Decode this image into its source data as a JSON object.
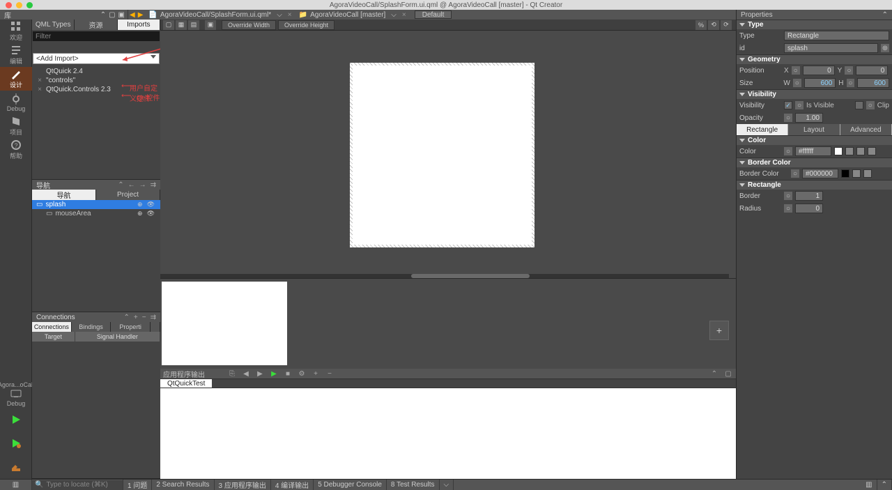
{
  "title": "AgoraVideoCall/SplashForm.ui.qml @ AgoraVideoCall [master] - Qt Creator",
  "filebar": {
    "library_label": "库",
    "crumb": "AgoraVideoCall/SplashForm.ui.qml*",
    "crumb2": "AgoraVideoCall [master]",
    "default_kit": "Default"
  },
  "rail": {
    "welcome": "欢迎",
    "edit": "编辑",
    "design": "设计",
    "debug": "Debug",
    "projects": "项目",
    "help": "帮助",
    "kit": "Agora...oCall",
    "kit2": "Debug"
  },
  "library": {
    "tabs": {
      "qml_types": "QML Types",
      "resources": "资源",
      "imports": "Imports"
    },
    "filter_placeholder": "Filter",
    "add_import": "<Add Import>",
    "items": [
      {
        "x": false,
        "label": "QtQuick 2.4"
      },
      {
        "x": true,
        "label": "\"controls\""
      },
      {
        "x": true,
        "label": "QtQuick.Controls 2.3"
      }
    ],
    "anno1": "用户自定义控件",
    "anno2": "Qt 控件"
  },
  "navigator": {
    "title": "导航",
    "tabs": {
      "nav": "导航",
      "project": "Project"
    },
    "rows": [
      {
        "label": "splash",
        "icon": "rect"
      },
      {
        "label": "mouseArea",
        "icon": "mouse"
      }
    ]
  },
  "connections": {
    "title": "Connections",
    "tabs": {
      "connections": "Connections",
      "bindings": "Bindings",
      "properties": "Properti"
    },
    "sub": {
      "target": "Target",
      "signal": "Signal Handler"
    }
  },
  "centerToolbar": {
    "override_width": "Override Width",
    "override_height": "Override Height"
  },
  "states": {
    "add": "+"
  },
  "output": {
    "title": "应用程序输出",
    "tab": "QtQuickTest"
  },
  "properties": {
    "title": "Properties",
    "type_section": "Type",
    "type_value": "Rectangle",
    "id_label": "id",
    "id_value": "splash",
    "geometry_section": "Geometry",
    "position_label": "Position",
    "size_label": "Size",
    "x": "X",
    "y": "Y",
    "w": "W",
    "h": "H",
    "xv": "0",
    "yv": "0",
    "wv": "600",
    "hv": "600",
    "visibility_section": "Visibility",
    "visibility_label": "Visibility",
    "is_visible": "Is Visible",
    "clip": "Clip",
    "opacity_label": "Opacity",
    "opacity_value": "1.00",
    "tabs": {
      "rectangle": "Rectangle",
      "layout": "Layout",
      "advanced": "Advanced"
    },
    "color_section": "Color",
    "color_label": "Color",
    "color_value": "#ffffff",
    "border_color_section": "Border Color",
    "border_color_label": "Border Color",
    "border_color_value": "#000000",
    "rectangle_section": "Rectangle",
    "border_label": "Border",
    "border_value": "1",
    "radius_label": "Radius",
    "radius_value": "0"
  },
  "statusbar": {
    "search_placeholder": "Type to locate (⌘K)",
    "items": [
      "1  问题",
      "2  Search Results",
      "3  应用程序输出",
      "4  编译输出",
      "5  Debugger Console",
      "8  Test Results"
    ]
  }
}
